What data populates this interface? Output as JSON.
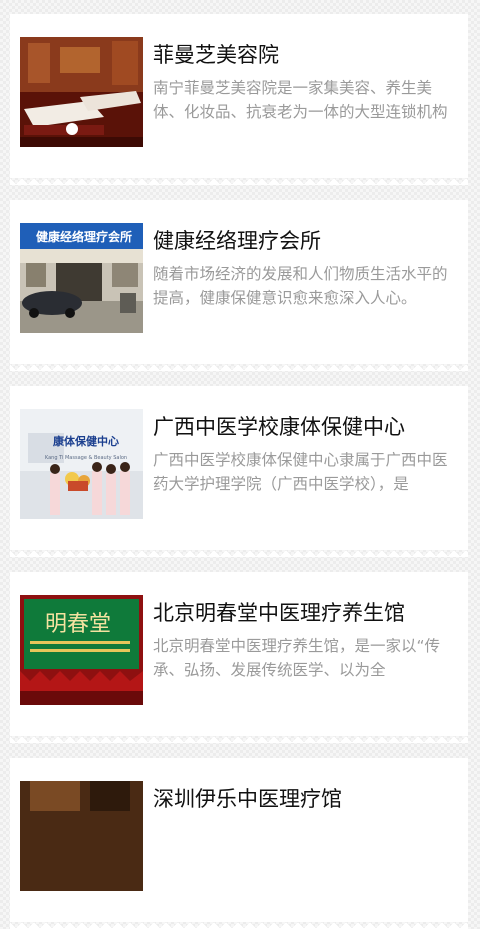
{
  "listings": [
    {
      "title": "菲曼芝美容院",
      "description": "南宁菲曼芝美容院是一家集美容、养生美体、化妆品、抗衰老为一体的大型连锁机构",
      "image": "spa-room-photo"
    },
    {
      "title": "健康经络理疗会所",
      "description": "随着市场经济的发展和人们物质生活水平的提高，健康保健意识愈来愈深入人心。",
      "image": "storefront-photo",
      "image_sign_text": "健康经络理疗会所"
    },
    {
      "title": "广西中医学校康体保健中心",
      "description": "广西中医学校康体保健中心隶属于广西中医药大学护理学院（广西中医学校），是",
      "image": "staff-group-photo",
      "image_sign_text": "康体保健中心",
      "image_sign_subtext": "Kang Ti Massage & Beauty Salon"
    },
    {
      "title": "北京明春堂中医理疗养生馆",
      "description": "北京明春堂中医理疗养生馆，是一家以“传承、弘扬、发展传统医学、以为全",
      "image": "signboard-photo",
      "image_sign_text": "明春堂"
    },
    {
      "title": "深圳伊乐中医理疗馆",
      "description": "",
      "image": "interior-photo"
    }
  ]
}
